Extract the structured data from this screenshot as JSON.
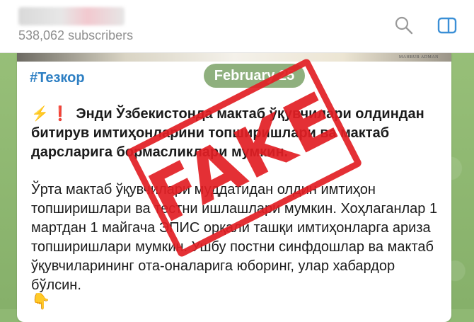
{
  "header": {
    "subscribers": "538,062 subscribers",
    "search_icon": "search-icon",
    "sidebar_icon": "sidebar-toggle-icon"
  },
  "message": {
    "media_caption": "MAHBUB ADMAN",
    "hashtag": "#Тезкор",
    "date": "February 25",
    "headline_emoji_1": "⚡",
    "headline_emoji_2": "❗",
    "headline": "Энди Ўзбекистонда мактаб ўқувчилари олдиндан битирув имтиҳонларини топширишлари ва мактаб дарсларига бормасликлари мумкин.",
    "body": "Ўрта мактаб ўқувчилари муддатидан олдин имтиҳон топширишлари ва тестни ишлашлари мумкин. Хоҳлаганлар 1 мартдан 1 майгача ЭПИС орқали ташқи имтиҳонларга ариза топширишлари мумкин. Ушбу постни синфдошлар ва мактаб ўқувчиларининг ота-оналарига юборинг, улар хабардор бўлсин.",
    "pointer_emoji": "👇"
  },
  "stamp": {
    "text": "FAKE",
    "color": "#e21e24"
  },
  "colors": {
    "accent_link": "#2d7fc3",
    "date_badge": "#8fb07e",
    "wallpaper": "#8fb873"
  }
}
